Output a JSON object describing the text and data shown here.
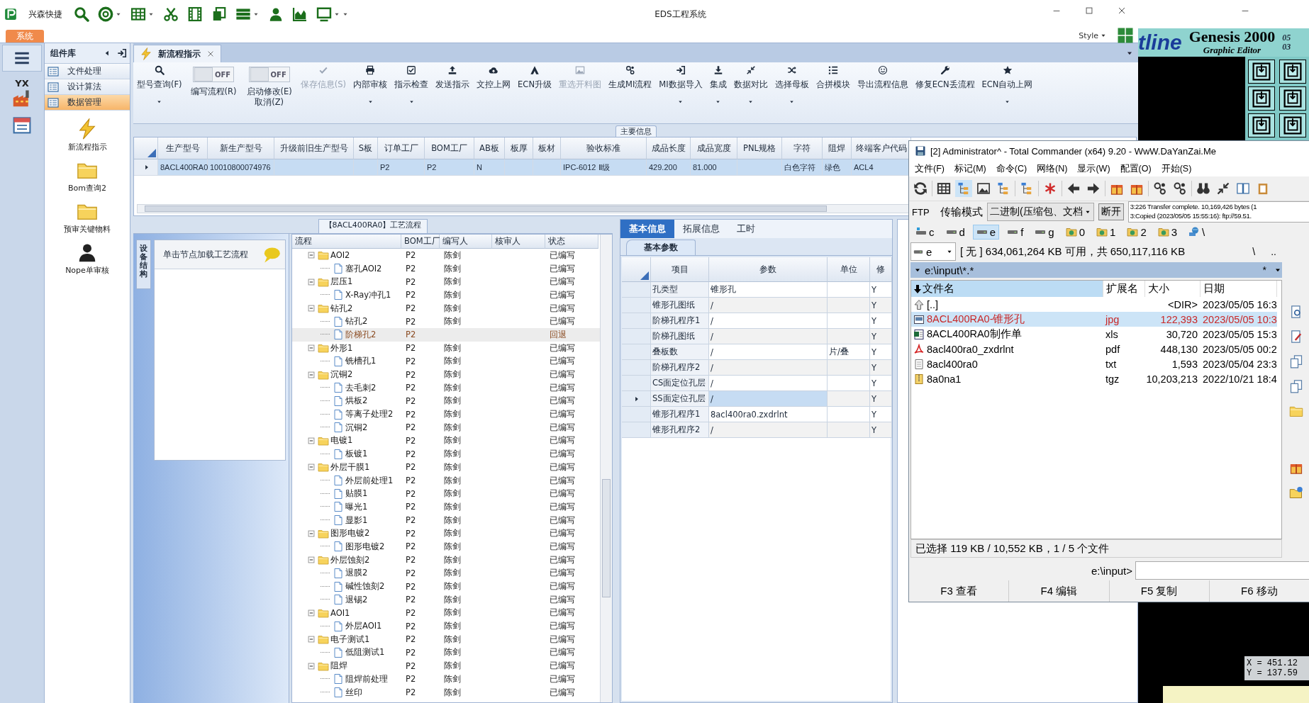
{
  "main_window": {
    "quick_access": {
      "label": "兴森快捷"
    },
    "title": "EDS工程系统",
    "ribbon_tab": {
      "label": "系统",
      "selected": true
    },
    "style_menu": {
      "label": "Style"
    },
    "rail": {
      "logo_text": "YX"
    },
    "component_library": {
      "title": "组件库",
      "items": [
        {
          "label": "文件处理",
          "selected": false
        },
        {
          "label": "设计算法",
          "selected": false
        },
        {
          "label": "数据管理",
          "selected": true
        }
      ],
      "tools": [
        {
          "label": "新流程指示"
        },
        {
          "label": "Bom查询2"
        },
        {
          "label": "预审关键物料"
        },
        {
          "label": "Nope单审核"
        }
      ]
    },
    "document_tab": {
      "label": "新流程指示",
      "selected": true
    },
    "toolbar": [
      {
        "kind": "button",
        "label": "型号查询(F)",
        "dropdown": true,
        "disabled": false
      },
      {
        "kind": "toggle",
        "state_text": "OFF",
        "on": false,
        "label": "编写流程(R)"
      },
      {
        "kind": "toggle",
        "state_text": "OFF",
        "on": false,
        "label": "启动修改(E)",
        "sublabel": "取消(Z)"
      },
      {
        "kind": "button",
        "label": "保存信息(S)",
        "dropdown": false,
        "disabled": true
      },
      {
        "kind": "button",
        "label": "内部审核",
        "dropdown": true,
        "disabled": false
      },
      {
        "kind": "button",
        "label": "指示检查",
        "dropdown": true,
        "disabled": false
      },
      {
        "kind": "button",
        "label": "发送指示",
        "dropdown": false,
        "disabled": false
      },
      {
        "kind": "button",
        "label": "文控上网",
        "dropdown": false,
        "disabled": false
      },
      {
        "kind": "button",
        "label": "ECN升级",
        "dropdown": false,
        "disabled": false
      },
      {
        "kind": "button",
        "label": "重选开料图",
        "dropdown": false,
        "disabled": true
      },
      {
        "kind": "button",
        "label": "生成MI流程",
        "dropdown": false,
        "disabled": false
      },
      {
        "kind": "button",
        "label": "MI数据导入",
        "dropdown": true,
        "disabled": false
      },
      {
        "kind": "button",
        "label": "集成",
        "dropdown": true,
        "disabled": false
      },
      {
        "kind": "button",
        "label": "数据对比",
        "dropdown": true,
        "disabled": false
      },
      {
        "kind": "button",
        "label": "选择母板",
        "dropdown": true,
        "disabled": false
      },
      {
        "kind": "button",
        "label": "合拼模块",
        "dropdown": false,
        "disabled": false
      },
      {
        "kind": "button",
        "label": "导出流程信息",
        "dropdown": false,
        "disabled": false
      },
      {
        "kind": "button",
        "label": "修复ECN丢流程",
        "dropdown": false,
        "disabled": false
      },
      {
        "kind": "button",
        "label": "ECN自动上网",
        "dropdown": true,
        "disabled": false
      }
    ],
    "main_info": {
      "title": "主要信息",
      "columns": [
        "生产型号",
        "新生产型号",
        "升级前旧生产型号",
        "S板",
        "订单工厂",
        "BOM工厂",
        "AB板",
        "板厚",
        "板材",
        "验收标准",
        "成品长度",
        "成品宽度",
        "PNL规格",
        "字符",
        "阻焊",
        "终端客户代码"
      ],
      "rows": [
        {
          "selected": true,
          "cells": [
            "8ACL400RA0",
            "10010800074976",
            null,
            null,
            "P2",
            "P2",
            "N",
            null,
            null,
            "IPC-6012 Ⅱ级",
            "429.200",
            "81.000",
            null,
            "白色字符",
            "绿色",
            "ACL4"
          ]
        }
      ]
    },
    "process": {
      "title": "【8ACL400RA0】工艺流程",
      "side_tab": "设备结构",
      "hint": "单击节点加载工艺流程",
      "columns": [
        "流程",
        "BOM工厂",
        "编写人",
        "核审人",
        "状态"
      ],
      "tree": [
        {
          "name": "AOI2",
          "bom": "P2",
          "writer": "陈剑",
          "status": "已编写",
          "selected": false,
          "expanded": true,
          "children": [
            {
              "name": "塞孔AOI2",
              "bom": "P2",
              "writer": "陈剑",
              "status": "已编写",
              "selected": false
            }
          ]
        },
        {
          "name": "层压1",
          "bom": "P2",
          "writer": "陈剑",
          "status": "已编写",
          "selected": false,
          "expanded": true,
          "children": [
            {
              "name": "X-Ray冲孔1",
              "bom": "P2",
              "writer": "陈剑",
              "status": "已编写",
              "selected": false
            }
          ]
        },
        {
          "name": "钻孔2",
          "bom": "P2",
          "writer": "陈剑",
          "status": "已编写",
          "selected": false,
          "expanded": true,
          "children": [
            {
              "name": "钻孔2",
              "bom": "P2",
              "writer": "陈剑",
              "status": "已编写",
              "selected": false
            },
            {
              "name": "阶梯孔2",
              "bom": "P2",
              "status": "回退",
              "selected": true
            }
          ]
        },
        {
          "name": "外形1",
          "bom": "P2",
          "writer": "陈剑",
          "status": "已编写",
          "selected": false,
          "expanded": true,
          "children": [
            {
              "name": "铣槽孔1",
              "bom": "P2",
              "writer": "陈剑",
              "status": "已编写",
              "selected": false
            }
          ]
        },
        {
          "name": "沉铜2",
          "bom": "P2",
          "writer": "陈剑",
          "status": "已编写",
          "selected": false,
          "expanded": true,
          "children": [
            {
              "name": "去毛刺2",
              "bom": "P2",
              "writer": "陈剑",
              "status": "已编写",
              "selected": false
            },
            {
              "name": "烘板2",
              "bom": "P2",
              "writer": "陈剑",
              "status": "已编写",
              "selected": false
            },
            {
              "name": "等离子处理2",
              "bom": "P2",
              "writer": "陈剑",
              "status": "已编写",
              "selected": false
            },
            {
              "name": "沉铜2",
              "bom": "P2",
              "writer": "陈剑",
              "status": "已编写",
              "selected": false
            }
          ]
        },
        {
          "name": "电镀1",
          "bom": "P2",
          "writer": "陈剑",
          "status": "已编写",
          "selected": false,
          "expanded": true,
          "children": [
            {
              "name": "板镀1",
              "bom": "P2",
              "writer": "陈剑",
              "status": "已编写",
              "selected": false
            }
          ]
        },
        {
          "name": "外层干膜1",
          "bom": "P2",
          "writer": "陈剑",
          "status": "已编写",
          "selected": false,
          "expanded": true,
          "children": [
            {
              "name": "外层前处理1",
              "bom": "P2",
              "writer": "陈剑",
              "status": "已编写",
              "selected": false
            },
            {
              "name": "贴膜1",
              "bom": "P2",
              "writer": "陈剑",
              "status": "已编写",
              "selected": false
            },
            {
              "name": "曝光1",
              "bom": "P2",
              "writer": "陈剑",
              "status": "已编写",
              "selected": false
            },
            {
              "name": "显影1",
              "bom": "P2",
              "writer": "陈剑",
              "status": "已编写",
              "selected": false
            }
          ]
        },
        {
          "name": "图形电镀2",
          "bom": "P2",
          "writer": "陈剑",
          "status": "已编写",
          "selected": false,
          "expanded": true,
          "children": [
            {
              "name": "图形电镀2",
              "bom": "P2",
              "writer": "陈剑",
              "status": "已编写",
              "selected": false
            }
          ]
        },
        {
          "name": "外层蚀刻2",
          "bom": "P2",
          "writer": "陈剑",
          "status": "已编写",
          "selected": false,
          "expanded": true,
          "children": [
            {
              "name": "退膜2",
              "bom": "P2",
              "writer": "陈剑",
              "status": "已编写",
              "selected": false
            },
            {
              "name": "碱性蚀刻2",
              "bom": "P2",
              "writer": "陈剑",
              "status": "已编写",
              "selected": false
            },
            {
              "name": "退锡2",
              "bom": "P2",
              "writer": "陈剑",
              "status": "已编写",
              "selected": false
            }
          ]
        },
        {
          "name": "AOI1",
          "bom": "P2",
          "writer": "陈剑",
          "status": "已编写",
          "selected": false,
          "expanded": true,
          "children": [
            {
              "name": "外层AOI1",
              "bom": "P2",
              "writer": "陈剑",
              "status": "已编写",
              "selected": false
            }
          ]
        },
        {
          "name": "电子测试1",
          "bom": "P2",
          "writer": "陈剑",
          "status": "已编写",
          "selected": false,
          "expanded": true,
          "children": [
            {
              "name": "低阻测试1",
              "bom": "P2",
              "writer": "陈剑",
              "status": "已编写",
              "selected": false
            }
          ]
        },
        {
          "name": "阻焊",
          "bom": "P2",
          "writer": "陈剑",
          "status": "已编写",
          "selected": false,
          "expanded": true,
          "children": [
            {
              "name": "阻焊前处理",
              "bom": "P2",
              "writer": "陈剑",
              "status": "已编写",
              "selected": false
            },
            {
              "name": "丝印",
              "bom": "P2",
              "writer": "陈剑",
              "status": "已编写",
              "selected": false
            }
          ]
        }
      ]
    },
    "detail": {
      "tabs": [
        {
          "label": "基本信息",
          "selected": true
        },
        {
          "label": "拓展信息",
          "selected": false
        },
        {
          "label": "工时",
          "selected": false
        }
      ],
      "subtab": "基本参数",
      "columns": [
        "项目",
        "参数",
        "单位",
        "修"
      ],
      "rows": [
        {
          "item": "孔类型",
          "param": "锥形孔",
          "flag": "Y",
          "selected": false
        },
        {
          "item": "锥形孔图纸",
          "param": "/",
          "flag": "Y",
          "selected": false
        },
        {
          "item": "阶梯孔程序1",
          "param": "/",
          "flag": "Y",
          "selected": false
        },
        {
          "item": "阶梯孔图纸",
          "param": "/",
          "flag": "Y",
          "selected": false
        },
        {
          "item": "叠板数",
          "param": "/",
          "unit": "片/叠",
          "flag": "Y",
          "selected": false
        },
        {
          "item": "阶梯孔程序2",
          "param": "/",
          "flag": "Y",
          "selected": false
        },
        {
          "item": "CS面定位孔层",
          "param": "/",
          "flag": "Y",
          "selected": false
        },
        {
          "item": "SS面定位孔层",
          "param": "/",
          "flag": "Y",
          "selected": true
        },
        {
          "item": "锥形孔程序1",
          "param": "8acl400ra0.zxdrlnt",
          "flag": "Y",
          "selected": false
        },
        {
          "item": "锥形孔程序2",
          "param": "/",
          "flag": "Y",
          "selected": false
        }
      ]
    }
  },
  "genesis": {
    "brand": "tline",
    "title": "Genesis 2000",
    "subtitle": "Graphic Editor",
    "codes": [
      "05",
      "03"
    ],
    "coords": [
      "X = 451.12",
      "Y = 137.59"
    ]
  },
  "total_commander": {
    "title": "[2] Administrator^ - Total Commander (x64) 9.20 - WwW.DaYanZai.Me",
    "menu": [
      "文件(F)",
      "标记(M)",
      "命令(C)",
      "网络(N)",
      "显示(W)",
      "配置(O)",
      "开始(S)"
    ],
    "ftp": {
      "label": "FTP",
      "mode_label": "传输模式",
      "mode": "二进制(压缩包、文档",
      "disconnect": "断开",
      "log": [
        "3:226 Transfer complete. 10,169,426 bytes (1",
        "3:Copied (2023/05/05 15:55:16): ftp://59.51."
      ]
    },
    "drives": [
      {
        "label": "c",
        "kind": "network",
        "selected": false
      },
      {
        "label": "d",
        "kind": "drive",
        "selected": false
      },
      {
        "label": "e",
        "kind": "drive",
        "selected": true
      },
      {
        "label": "f",
        "kind": "drive",
        "selected": false
      },
      {
        "label": "g",
        "kind": "drive",
        "selected": false
      },
      {
        "label": "0",
        "kind": "folder",
        "selected": false
      },
      {
        "label": "1",
        "kind": "folder",
        "selected": false
      },
      {
        "label": "2",
        "kind": "folder",
        "selected": false
      },
      {
        "label": "3",
        "kind": "folder",
        "selected": false
      },
      {
        "label": "\\",
        "kind": "globe",
        "selected": false
      }
    ],
    "drive_select": "e",
    "free_space": "[ 无 ] 634,061,264 KB 可用，共 650,117,116 KB",
    "nav": [
      "\\",
      ".."
    ],
    "path": "e:\\input\\*.*",
    "filter": "*",
    "columns": [
      "文件名",
      "扩展名",
      "大小",
      "日期"
    ],
    "files": [
      {
        "kind": "up",
        "name": "[..]",
        "size": "<DIR>",
        "date": "2023/05/05 16:3",
        "selected": false
      },
      {
        "kind": "image",
        "name": "8ACL400RA0-锥形孔",
        "ext": "jpg",
        "size": "122,393",
        "date": "2023/05/05 10:3",
        "selected": true
      },
      {
        "kind": "spreadsheet",
        "name": "8ACL400RA0制作单",
        "ext": "xls",
        "size": "30,720",
        "date": "2023/05/05 15:3",
        "selected": false
      },
      {
        "kind": "pdf",
        "name": "8acl400ra0_zxdrlnt",
        "ext": "pdf",
        "size": "448,130",
        "date": "2023/05/05 00:2",
        "selected": false
      },
      {
        "kind": "text",
        "name": "8acl400ra0",
        "ext": "txt",
        "size": "1,593",
        "date": "2023/05/04 23:3",
        "selected": false
      },
      {
        "kind": "archive",
        "name": "8a0na1",
        "ext": "tgz",
        "size": "10,203,213",
        "date": "2022/10/21 18:4",
        "selected": false
      }
    ],
    "status": "已选择 119 KB / 10,552 KB，1 / 5 个文件",
    "command_prompt": "e:\\input>",
    "function_keys": [
      "F3 查看",
      "F4 编辑",
      "F5 复制",
      "F6 移动"
    ]
  }
}
